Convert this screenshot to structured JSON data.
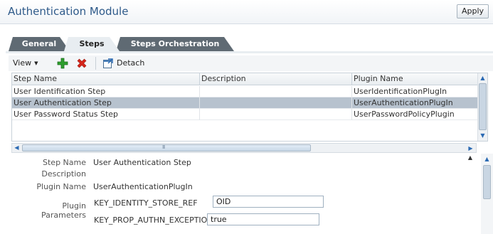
{
  "header": {
    "title": "Authentication Module",
    "apply_label": "Apply"
  },
  "tabs": [
    {
      "label": "General",
      "active": false
    },
    {
      "label": "Steps",
      "active": true
    },
    {
      "label": "Steps Orchestration",
      "active": false
    }
  ],
  "toolbar": {
    "view_label": "View",
    "add_icon": "add-plus-icon",
    "delete_icon": "delete-x-icon",
    "detach_icon": "detach-icon",
    "detach_label": "Detach"
  },
  "grid": {
    "columns": [
      "Step Name",
      "Description",
      "Plugin Name"
    ],
    "rows": [
      {
        "name": "User Identification Step",
        "description": "",
        "plugin": "UserIdentificationPlugIn",
        "selected": false
      },
      {
        "name": "User Authentication Step",
        "description": "",
        "plugin": "UserAuthenticationPlugIn",
        "selected": true
      },
      {
        "name": "User Password Status Step",
        "description": "",
        "plugin": "UserPasswordPolicyPlugin",
        "selected": false
      }
    ],
    "hscroll_grip": "III"
  },
  "detail": {
    "step_name_label": "Step Name",
    "step_name_value": "User Authentication Step",
    "description_label": "Description",
    "description_value": "",
    "plugin_name_label": "Plugin Name",
    "plugin_name_value": "UserAuthenticationPlugIn",
    "plugin_params_label_1": "Plugin",
    "plugin_params_label_2": "Parameters",
    "params": [
      {
        "key": "KEY_IDENTITY_STORE_REF",
        "value": "OID"
      },
      {
        "key": "KEY_PROP_AUTHN_EXCEPTION",
        "value": "true"
      }
    ]
  },
  "colors": {
    "title": "#2e5a8a",
    "selected_row": "#b7c2ce",
    "tab_dark": "#5f6a73",
    "add": "#2e9e2e",
    "delete": "#d6261b"
  }
}
